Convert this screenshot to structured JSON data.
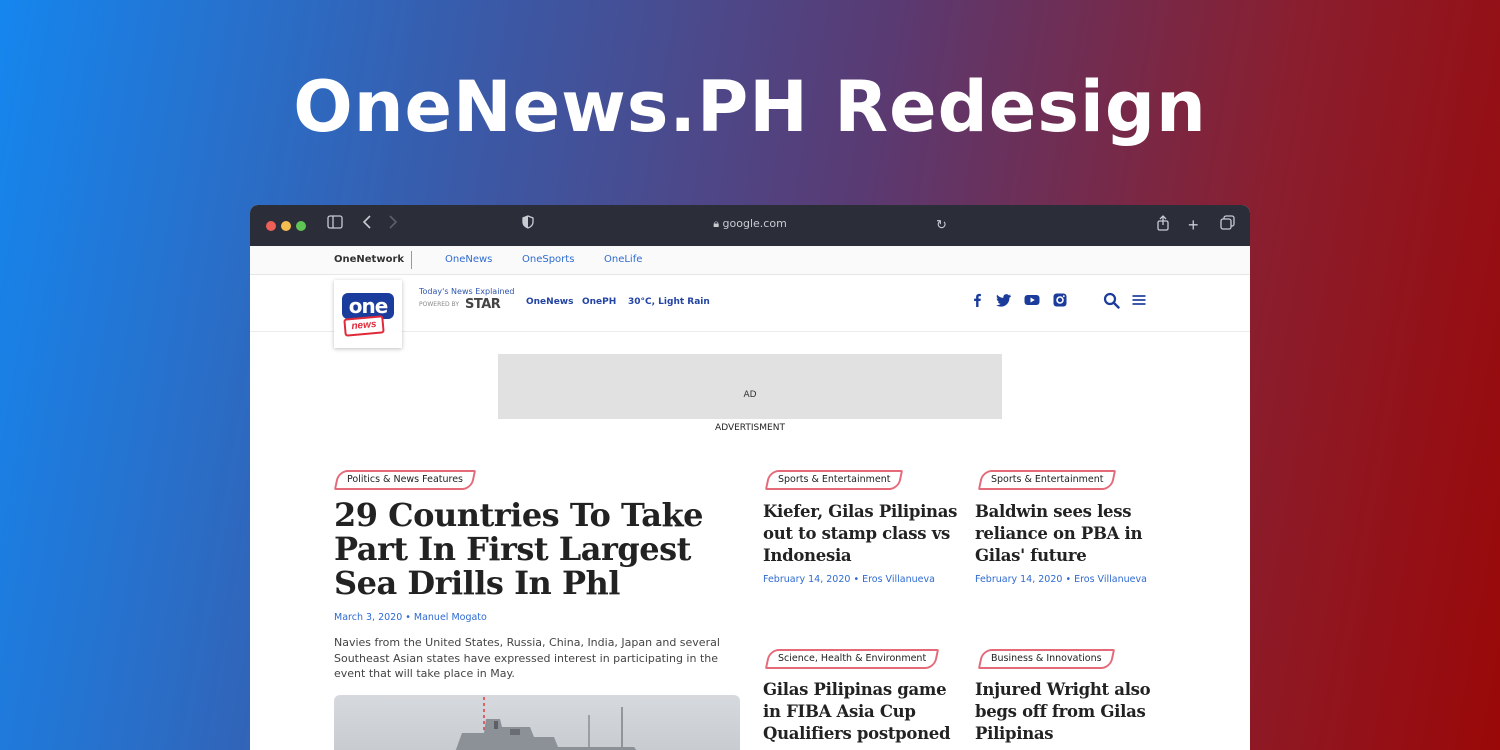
{
  "hero": {
    "title": "OneNews.PH Redesign"
  },
  "browser": {
    "url": "google.com"
  },
  "network": {
    "brand": "OneNetwork",
    "links": [
      "OneNews",
      "OneSports",
      "OneLife"
    ]
  },
  "header": {
    "logo_one": "one",
    "logo_news": "news",
    "tagline": "Today's News Explained",
    "powered_by": "POWERED BY",
    "star": "STAR",
    "nav": [
      "OneNews",
      "OnePH",
      "30°C, Light Rain"
    ]
  },
  "ad": {
    "box_text": "AD",
    "label": "ADVERTISMENT"
  },
  "main_article": {
    "category": "Politics & News Features",
    "title": "29 Countries To Take Part In First Largest Sea Drills In Phl",
    "meta": "March 3, 2020 • Manuel Mogato",
    "excerpt": "Navies from the United States, Russia, China, India, Japan and several Southeast Asian states have expressed interest in participating in the event that will take place in May."
  },
  "side_articles": [
    {
      "category": "Sports & Entertainment",
      "title": "Kiefer, Gilas Pilipinas out to stamp class vs Indonesia",
      "meta": "February 14, 2020 • Eros Villanueva"
    },
    {
      "category": "Sports & Entertainment",
      "title": "Baldwin sees less reliance on PBA in Gilas' future",
      "meta": "February 14, 2020 • Eros Villanueva"
    },
    {
      "category": "Science, Health & Environment",
      "title": "Gilas Pilipinas game in FIBA Asia Cup Qualifiers postponed",
      "meta": ""
    },
    {
      "category": "Business & Innovations",
      "title": "Injured Wright also begs off from Gilas Pilipinas",
      "meta": ""
    }
  ],
  "colors": {
    "accent_blue": "#1b3c9a",
    "tag_border": "#e56a79",
    "link_blue": "#2f6bd0"
  }
}
